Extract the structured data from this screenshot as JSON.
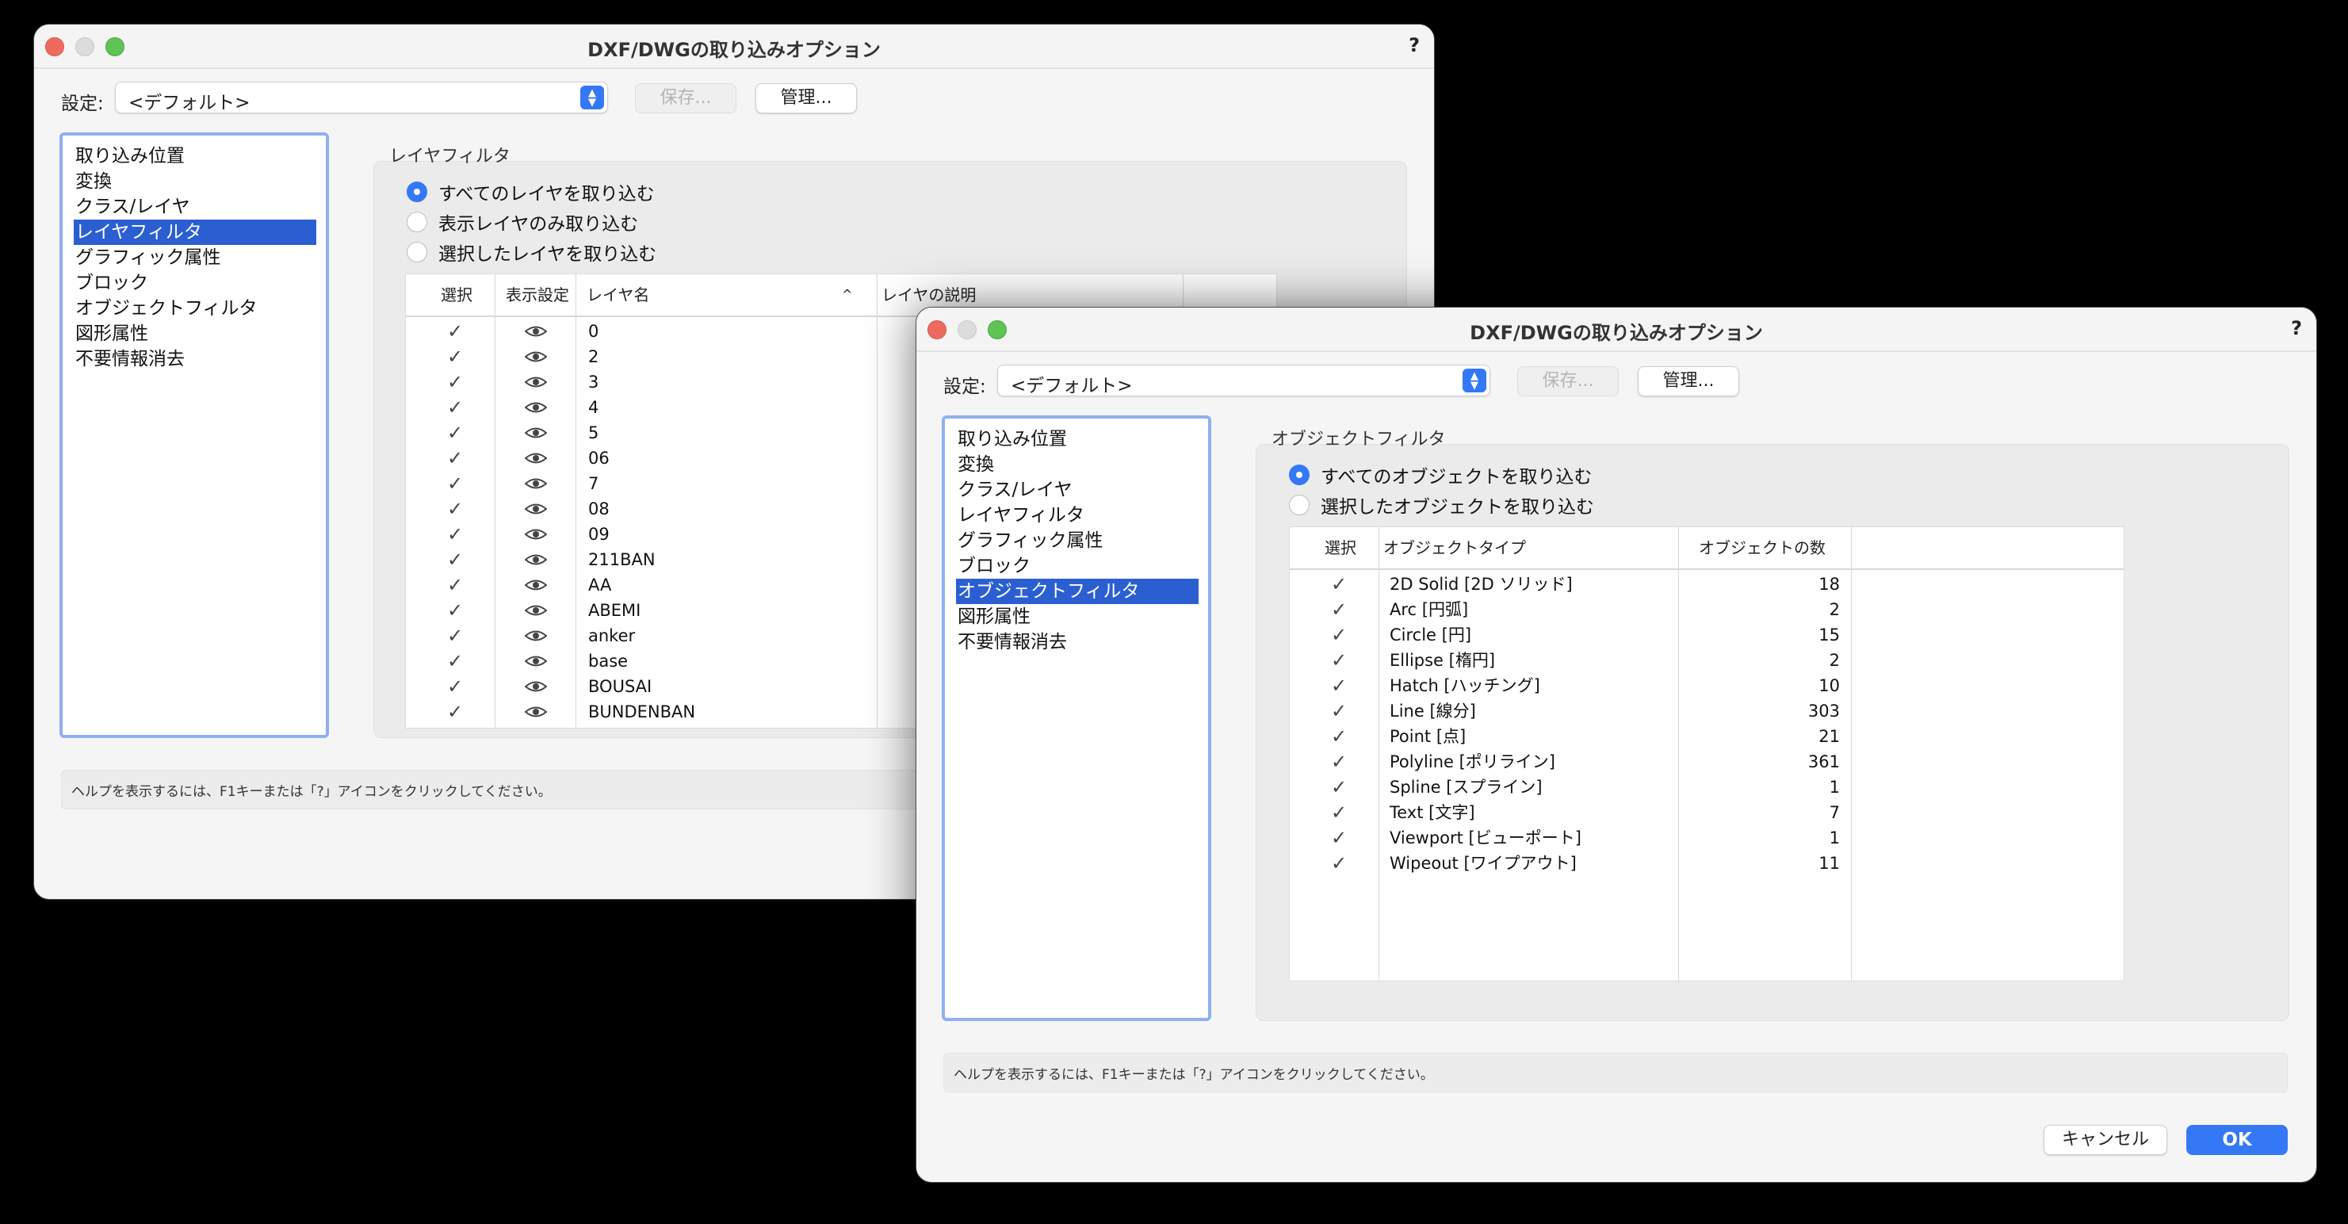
{
  "back_window": {
    "title": "DXF/DWGの取り込みオプション",
    "help_icon": "?",
    "settings_label": "設定:",
    "settings_value": "<デフォルト>",
    "save_label": "保存...",
    "manage_label": "管理...",
    "nav_items": [
      "取り込み位置",
      "変換",
      "クラス/レイヤ",
      "レイヤフィルタ",
      "グラフィック属性",
      "ブロック",
      "オブジェクトフィルタ",
      "図形属性",
      "不要情報消去"
    ],
    "active_nav": 3,
    "section_label": "レイヤフィルタ",
    "radios": [
      {
        "label": "すべてのレイヤを取り込む",
        "selected": true
      },
      {
        "label": "表示レイヤのみ取り込む",
        "selected": false
      },
      {
        "label": "選択したレイヤを取り込む",
        "selected": false
      }
    ],
    "table": {
      "headers": {
        "select": "選択",
        "visibility": "表示設定",
        "name": "レイヤ名",
        "sort_arrow": "^",
        "description": "レイヤの説明"
      },
      "check_glyph": "✓",
      "rows": [
        "0",
        "2",
        "3",
        "4",
        "5",
        "06",
        "7",
        "08",
        "09",
        "211BAN",
        "AA",
        "ABEMI",
        "anker",
        "base",
        "BOUSAI",
        "BUNDENBAN"
      ]
    },
    "help_text": "ヘルプを表示するには、F1キーまたは「?」アイコンをクリックしてください。"
  },
  "front_window": {
    "title": "DXF/DWGの取り込みオプション",
    "help_icon": "?",
    "settings_label": "設定:",
    "settings_value": "<デフォルト>",
    "save_label": "保存...",
    "manage_label": "管理...",
    "nav_items": [
      "取り込み位置",
      "変換",
      "クラス/レイヤ",
      "レイヤフィルタ",
      "グラフィック属性",
      "ブロック",
      "オブジェクトフィルタ",
      "図形属性",
      "不要情報消去"
    ],
    "active_nav": 6,
    "section_label": "オブジェクトフィルタ",
    "radios": [
      {
        "label": "すべてのオブジェクトを取り込む",
        "selected": true
      },
      {
        "label": "選択したオブジェクトを取り込む",
        "selected": false
      }
    ],
    "table": {
      "headers": {
        "select": "選択",
        "type": "オブジェクトタイプ",
        "count": "オブジェクトの数"
      },
      "check_glyph": "✓",
      "rows": [
        {
          "type": "2D Solid [2D ソリッド]",
          "count": "18"
        },
        {
          "type": "Arc [円弧]",
          "count": "2"
        },
        {
          "type": "Circle [円]",
          "count": "15"
        },
        {
          "type": "Ellipse [楕円]",
          "count": "2"
        },
        {
          "type": "Hatch [ハッチング]",
          "count": "10"
        },
        {
          "type": "Line [線分]",
          "count": "303"
        },
        {
          "type": "Point [点]",
          "count": "21"
        },
        {
          "type": "Polyline [ポリライン]",
          "count": "361"
        },
        {
          "type": "Spline [スプライン]",
          "count": "1"
        },
        {
          "type": "Text [文字]",
          "count": "7"
        },
        {
          "type": "Viewport [ビューポート]",
          "count": "1"
        },
        {
          "type": "Wipeout [ワイプアウト]",
          "count": "11"
        }
      ]
    },
    "help_text": "ヘルプを表示するには、F1キーまたは「?」アイコンをクリックしてください。",
    "cancel_label": "キャンセル",
    "ok_label": "OK"
  },
  "colors": {
    "accent": "#3478f6",
    "selection": "#2b5fd1",
    "focus_ring": "#8fb0f0"
  }
}
